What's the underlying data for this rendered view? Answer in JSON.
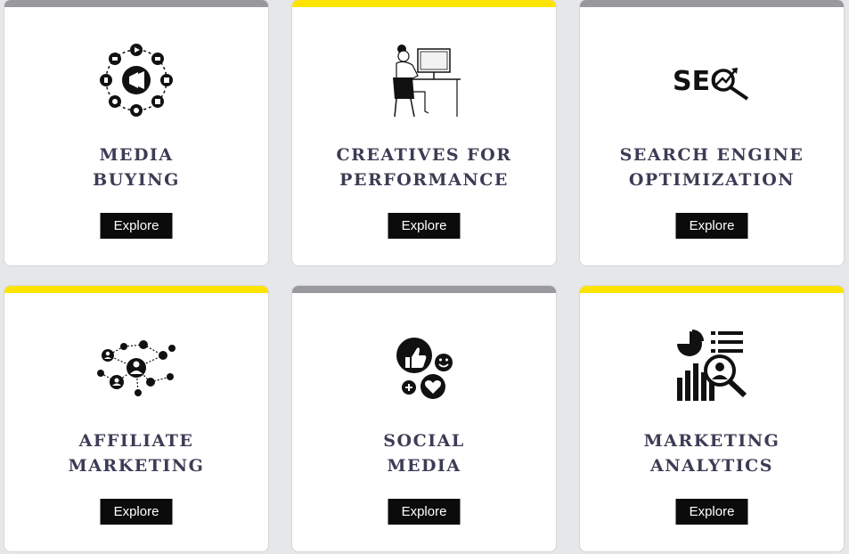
{
  "colors": {
    "accent_yellow": "#fde400",
    "accent_gray": "#98989d",
    "title": "#3c3c55",
    "button_bg": "#0b0b0b"
  },
  "cards": [
    {
      "title_line1": "MEDIA",
      "title_line2": "BUYING",
      "button": "Explore",
      "accent": "gray",
      "icon": "megaphone-network-icon"
    },
    {
      "title_line1": "CREATIVES FOR",
      "title_line2": "PERFORMANCE",
      "button": "Explore",
      "accent": "yellow",
      "icon": "designer-at-desk-icon"
    },
    {
      "title_line1": "SEARCH ENGINE",
      "title_line2": "OPTIMIZATION",
      "button": "Explore",
      "accent": "gray",
      "icon": "seo-magnifier-icon",
      "icon_text": "SEO"
    },
    {
      "title_line1": "AFFILIATE",
      "title_line2": "MARKETING",
      "button": "Explore",
      "accent": "yellow",
      "icon": "affiliate-network-icon"
    },
    {
      "title_line1": "SOCIAL",
      "title_line2": "MEDIA",
      "button": "Explore",
      "accent": "gray",
      "icon": "social-reactions-icon"
    },
    {
      "title_line1": "MARKETING",
      "title_line2": "ANALYTICS",
      "button": "Explore",
      "accent": "yellow",
      "icon": "analytics-report-icon"
    }
  ]
}
